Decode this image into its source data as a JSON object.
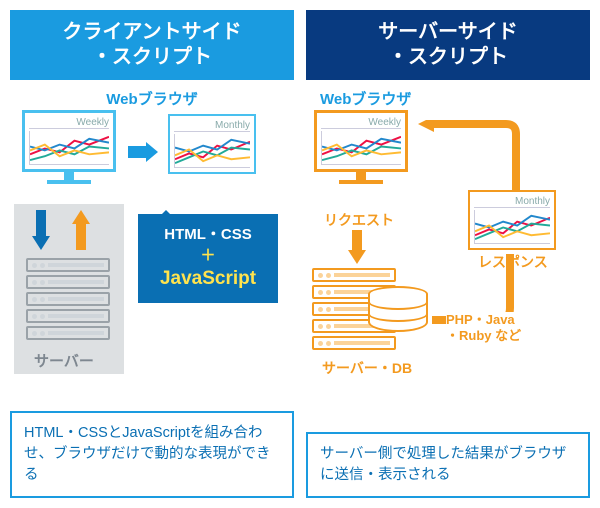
{
  "left": {
    "title_line1": "クライアントサイド",
    "title_line2": "・スクリプト",
    "browser_label": "Webブラウザ",
    "chart_weekly": "Weekly",
    "chart_monthly": "Monthly",
    "bubble_line1": "HTML・CSS",
    "bubble_plus": "＋",
    "bubble_js": "JavaScript",
    "server_label": "サーバー",
    "caption": "HTML・CSSとJavaScriptを組み合わせ、ブラウザだけで動的な表現ができる"
  },
  "right": {
    "title_line1": "サーバーサイド",
    "title_line2": "・スクリプト",
    "browser_label": "Webブラウザ",
    "chart_weekly": "Weekly",
    "chart_monthly": "Monthly",
    "request_label": "リクエスト",
    "response_label": "レスポンス",
    "serverdb_label": "サーバー・DB",
    "langs_line1": "PHP・Java",
    "langs_line2": "・Ruby など",
    "caption": "サーバー側で処理した結果がブラウザに送信・表示される"
  }
}
